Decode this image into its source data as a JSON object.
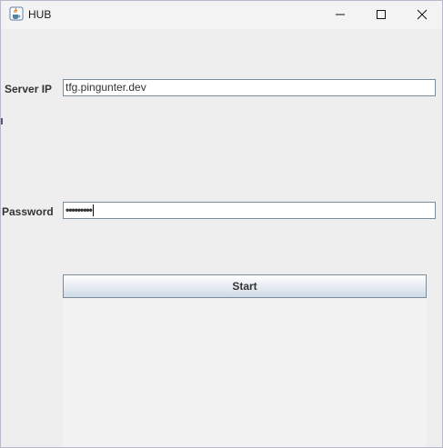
{
  "window": {
    "title": "HUB",
    "app_icon": "java-cup-icon",
    "controls": {
      "minimize_icon": "minimize-icon",
      "maximize_icon": "maximize-icon",
      "close_icon": "close-icon"
    }
  },
  "form": {
    "server_ip_label": "Server IP",
    "server_ip_value": "tfg.pingunter.dev",
    "password_label": "Password",
    "password_masked": "•••••••••",
    "start_label": "Start"
  },
  "colors": {
    "background": "#eeeeee",
    "field_border": "#7a8a99",
    "button_gradient_top": "#ffffff",
    "button_gradient_bottom": "#cfdbe7"
  }
}
